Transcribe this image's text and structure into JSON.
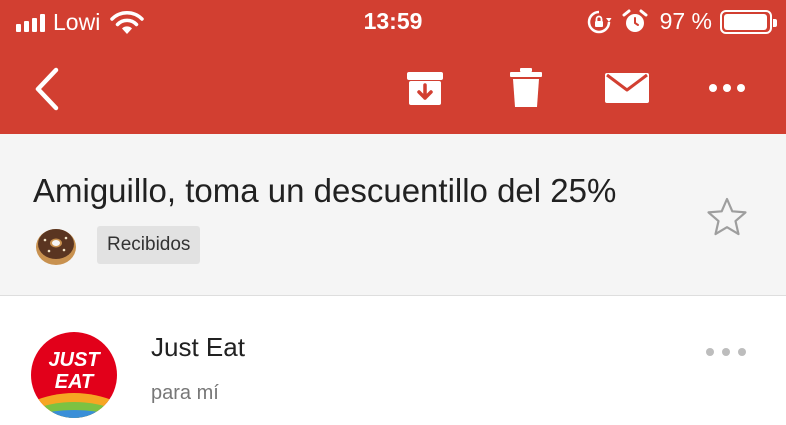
{
  "status_bar": {
    "carrier": "Lowi",
    "time": "13:59",
    "battery_percent": "97 %",
    "battery_level": 0.97,
    "icons": [
      "signal-icon",
      "wifi-icon",
      "rotation-lock-icon",
      "alarm-icon",
      "battery-icon"
    ]
  },
  "toolbar": {
    "icons": [
      "back-icon",
      "archive-icon",
      "trash-icon",
      "mail-icon",
      "more-icon"
    ]
  },
  "email": {
    "subject": "Amiguillo, toma un descuentillo del 25%",
    "label": "Recibidos",
    "sender": "Just Eat",
    "recipient": "para mí",
    "logo_text_line1": "JUST",
    "logo_text_line2": "EAT"
  },
  "colors": {
    "header": "#d23f31",
    "brand_logo": "#e2001a"
  }
}
